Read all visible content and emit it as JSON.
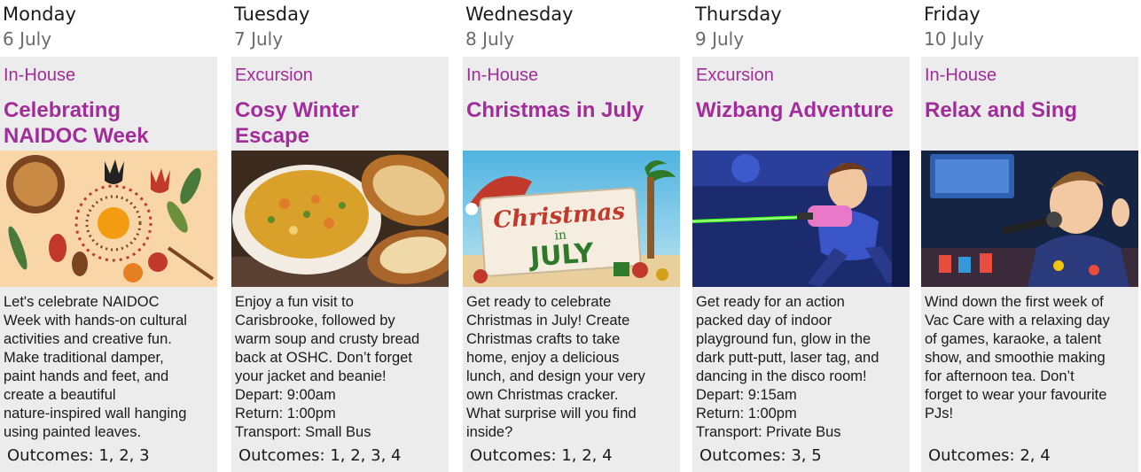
{
  "days": [
    {
      "day": "Monday",
      "date": "6 July",
      "category": "In-House",
      "title_lines": [
        "Celebrating",
        "NAIDOC Week"
      ],
      "image_icon": "naidoc-art-image",
      "description_lines": [
        "Let's celebrate NAIDOC",
        "Week with hands-on cultural",
        "activities and creative fun.",
        "Make traditional damper,",
        "paint hands and feet, and",
        "create a beautiful",
        "nature-inspired wall hanging",
        "using painted leaves."
      ],
      "outcomes_label": "Outcomes:",
      "outcomes": "1, 2, 3"
    },
    {
      "day": "Tuesday",
      "date": "7 July",
      "category": "Excursion",
      "title_lines": [
        "Cosy Winter",
        "Escape"
      ],
      "image_icon": "soup-and-bread-image",
      "description_lines": [
        "Enjoy a fun visit to",
        "Carisbrooke, followed by",
        "warm soup and crusty bread",
        "back at OSHC. Don’t forget",
        "your jacket and beanie!",
        "Depart: 9:00am",
        "Return: 1:00pm",
        "Transport: Small Bus"
      ],
      "outcomes_label": "Outcomes:",
      "outcomes": "1, 2, 3, 4"
    },
    {
      "day": "Wednesday",
      "date": "8 July",
      "category": "In-House",
      "title_lines": [
        "Christmas in July"
      ],
      "image_icon": "christmas-in-july-image",
      "image_text": [
        "Christmas",
        "in",
        "JULY"
      ],
      "description_lines": [
        "Get ready to celebrate",
        "Christmas in July! Create",
        "Christmas crafts to take",
        "home, enjoy a delicious",
        "lunch, and design your very",
        "own Christmas cracker.",
        "What surprise will you find",
        "inside?"
      ],
      "outcomes_label": "Outcomes:",
      "outcomes": "1, 2, 4"
    },
    {
      "day": "Thursday",
      "date": "9 July",
      "category": "Excursion",
      "title_lines": [
        "Wizbang Adventure"
      ],
      "image_icon": "laser-tag-image",
      "description_lines": [
        "Get ready for an action",
        "packed day of indoor",
        "playground fun, glow in the",
        "dark putt-putt, laser tag, and",
        "dancing in the disco room!",
        "Depart: 9:15am",
        "Return: 1:00pm",
        "Transport: Private Bus"
      ],
      "outcomes_label": "Outcomes:",
      "outcomes": "3, 5"
    },
    {
      "day": "Friday",
      "date": "10 July",
      "category": "In-House",
      "title_lines": [
        "Relax and Sing"
      ],
      "image_icon": "karaoke-image",
      "description_lines": [
        "Wind down the first week of",
        "Vac Care with a relaxing day",
        "of games, karaoke, a talent",
        "show, and smoothie making",
        "for afternoon tea. Don’t",
        "forget to wear your favourite",
        "PJs!"
      ],
      "outcomes_label": "Outcomes:",
      "outcomes": "2, 4"
    }
  ],
  "colors": {
    "accent": "#a32c9b",
    "card_background": "#ececec",
    "date_text": "#6b6b6b"
  }
}
